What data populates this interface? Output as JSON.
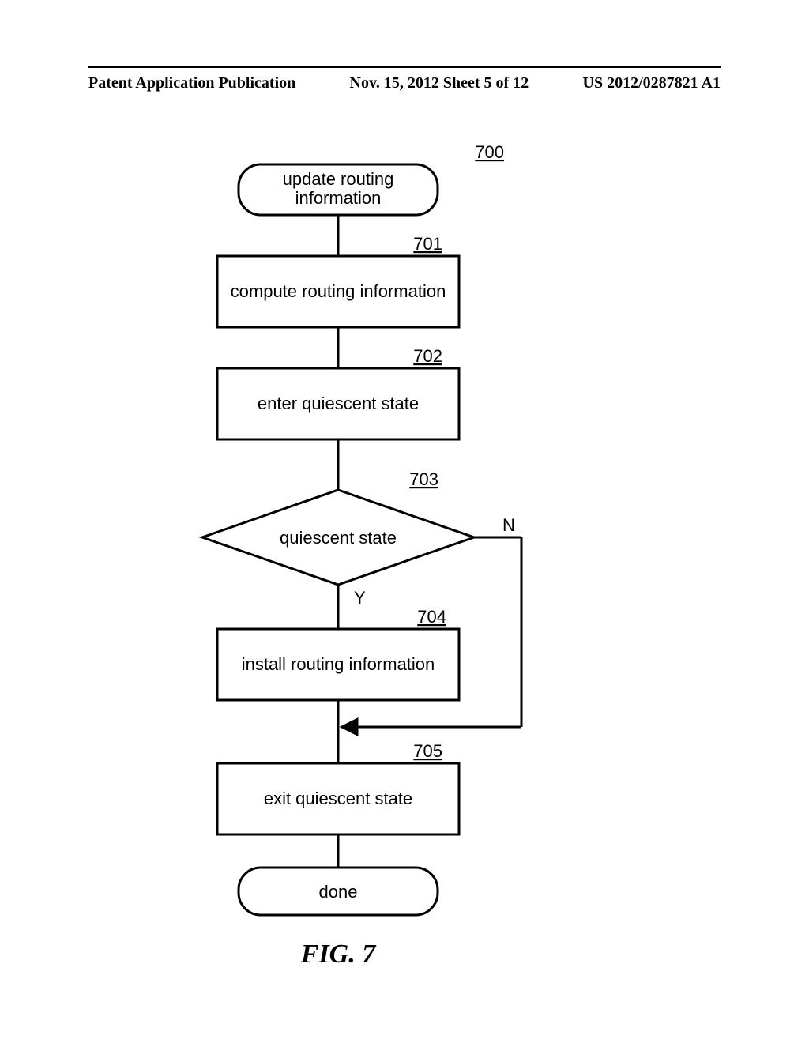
{
  "header": {
    "left": "Patent Application Publication",
    "center": "Nov. 15, 2012  Sheet 5 of 12",
    "right": "US 2012/0287821 A1"
  },
  "flow": {
    "ref_main": "700",
    "start": {
      "line1": "update routing",
      "line2": "information"
    },
    "ref_701": "701",
    "step_701": "compute routing information",
    "ref_702": "702",
    "step_702": "enter quiescent state",
    "ref_703": "703",
    "decision_703": "quiescent state",
    "branch_N": "N",
    "branch_Y": "Y",
    "ref_704": "704",
    "step_704": "install routing information",
    "ref_705": "705",
    "step_705": "exit quiescent state",
    "done": "done"
  },
  "figure_caption": "FIG. 7"
}
